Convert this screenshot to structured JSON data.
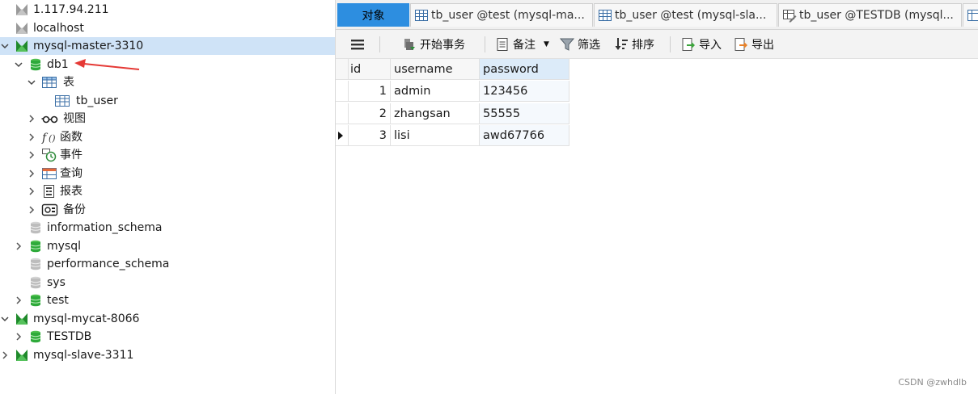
{
  "tree": {
    "items": [
      {
        "label": "1.117.94.211",
        "icon": "connection-icon-gray",
        "level": 0,
        "expand": "none"
      },
      {
        "label": "localhost",
        "icon": "connection-icon-gray",
        "level": 0,
        "expand": "none"
      },
      {
        "label": "mysql-master-3310",
        "icon": "connection-icon-green",
        "level": 0,
        "expand": "open",
        "selected": true
      },
      {
        "label": "db1",
        "icon": "database-icon-green",
        "level": 1,
        "expand": "open"
      },
      {
        "label": "表",
        "icon": "table-folder-icon",
        "level": 2,
        "expand": "open"
      },
      {
        "label": "tb_user",
        "icon": "table-icon",
        "level": 3,
        "expand": "none"
      },
      {
        "label": "视图",
        "icon": "view-icon",
        "level": 2,
        "expand": "closed"
      },
      {
        "label": "函数",
        "icon": "function-icon",
        "level": 2,
        "expand": "closed"
      },
      {
        "label": "事件",
        "icon": "event-icon",
        "level": 2,
        "expand": "closed"
      },
      {
        "label": "查询",
        "icon": "query-icon",
        "level": 2,
        "expand": "closed"
      },
      {
        "label": "报表",
        "icon": "report-icon",
        "level": 2,
        "expand": "closed"
      },
      {
        "label": "备份",
        "icon": "backup-icon",
        "level": 2,
        "expand": "closed"
      },
      {
        "label": "information_schema",
        "icon": "database-icon-gray",
        "level": 1,
        "expand": "none"
      },
      {
        "label": "mysql",
        "icon": "database-icon-green",
        "level": 1,
        "expand": "closed"
      },
      {
        "label": "performance_schema",
        "icon": "database-icon-gray",
        "level": 1,
        "expand": "none"
      },
      {
        "label": "sys",
        "icon": "database-icon-gray",
        "level": 1,
        "expand": "none"
      },
      {
        "label": "test",
        "icon": "database-icon-green",
        "level": 1,
        "expand": "closed"
      },
      {
        "label": "mysql-mycat-8066",
        "icon": "connection-icon-green",
        "level": 0,
        "expand": "open"
      },
      {
        "label": "TESTDB",
        "icon": "database-icon-green",
        "level": 1,
        "expand": "closed"
      },
      {
        "label": "mysql-slave-3311",
        "icon": "connection-icon-green",
        "level": 0,
        "expand": "closed"
      }
    ]
  },
  "tabs": [
    {
      "label": "对象",
      "icon": "",
      "active": true
    },
    {
      "label": "tb_user @test (mysql-ma...",
      "icon": "table-icon"
    },
    {
      "label": "tb_user @test (mysql-sla...",
      "icon": "table-icon"
    },
    {
      "label": "tb_user @TESTDB (mysql...",
      "icon": "table-design-icon"
    },
    {
      "label": "",
      "icon": "table-icon"
    }
  ],
  "toolbar": {
    "menu_icon": "hamburger-menu-icon",
    "begin_tx": "开始事务",
    "memo": "备注",
    "filter": "筛选",
    "sort": "排序",
    "import": "导入",
    "export": "导出"
  },
  "grid": {
    "columns": [
      "id",
      "username",
      "password"
    ],
    "rows": [
      {
        "id": "1",
        "username": "admin",
        "password": "123456",
        "current": false
      },
      {
        "id": "2",
        "username": "zhangsan",
        "password": "55555",
        "current": false
      },
      {
        "id": "3",
        "username": "lisi",
        "password": "awd67766",
        "current": true
      }
    ]
  },
  "colors": {
    "selected_row": "#cfe3f7",
    "active_tab": "#2d8ee0",
    "db_green": "#2eaa3a",
    "annotation_arrow": "#e53935"
  },
  "watermark": "CSDN @zwhdlb"
}
